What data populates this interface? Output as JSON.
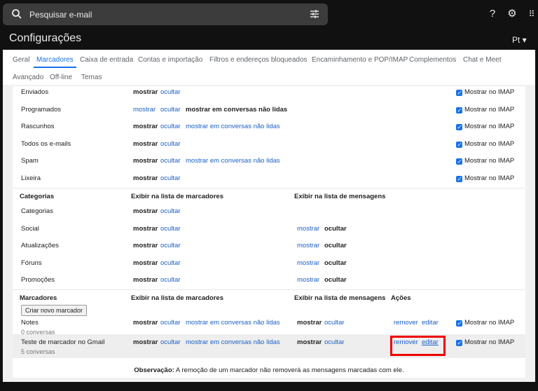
{
  "search": {
    "placeholder": "Pesquisar e-mail"
  },
  "header": {
    "title": "Configurações",
    "lang": "Pt ▾"
  },
  "tabs": [
    "Geral",
    "Marcadores",
    "Caixa de entrada",
    "Contas e importação",
    "Filtros e endereços bloqueados",
    "Encaminhamento e POP/IMAP",
    "Complementos",
    "Chat e Meet",
    "Avançado",
    "Off-line",
    "Temas"
  ],
  "system_labels": [
    {
      "name": "Enviados",
      "show": "mostrar",
      "hide": "ocultar",
      "unread": "",
      "imap": "Mostrar no IMAP",
      "bold": "show"
    },
    {
      "name": "Programados",
      "show": "mostrar",
      "hide": "ocultar",
      "unread": "mostrar em conversas não lidas",
      "imap": "Mostrar no IMAP",
      "bold": "unread"
    },
    {
      "name": "Rascunhos",
      "show": "mostrar",
      "hide": "ocultar",
      "unread": "mostrar em conversas não lidas",
      "imap": "Mostrar no IMAP",
      "bold": "show"
    },
    {
      "name": "Todos os e-mails",
      "show": "mostrar",
      "hide": "ocultar",
      "unread": "",
      "imap": "Mostrar no IMAP",
      "bold": "show"
    },
    {
      "name": "Spam",
      "show": "mostrar",
      "hide": "ocultar",
      "unread": "mostrar em conversas não lidas",
      "imap": "Mostrar no IMAP",
      "bold": "show"
    },
    {
      "name": "Lixeira",
      "show": "mostrar",
      "hide": "ocultar",
      "unread": "",
      "imap": "Mostrar no IMAP",
      "bold": "show"
    }
  ],
  "categories": {
    "header": "Categorias",
    "col_label_list": "Exibir na lista de marcadores",
    "col_msg_list": "Exibir na lista de mensagens",
    "rows": [
      {
        "name": "Categorias",
        "show": "mostrar",
        "hide": "ocultar",
        "mshow": "",
        "mhide": ""
      },
      {
        "name": "Social",
        "show": "mostrar",
        "hide": "ocultar",
        "mshow": "mostrar",
        "mhide": "ocultar"
      },
      {
        "name": "Atualizações",
        "show": "mostrar",
        "hide": "ocultar",
        "mshow": "mostrar",
        "mhide": "ocultar"
      },
      {
        "name": "Fóruns",
        "show": "mostrar",
        "hide": "ocultar",
        "mshow": "mostrar",
        "mhide": "ocultar"
      },
      {
        "name": "Promoções",
        "show": "mostrar",
        "hide": "ocultar",
        "mshow": "mostrar",
        "mhide": "ocultar"
      }
    ]
  },
  "labels": {
    "header": "Marcadores",
    "col_label_list": "Exibir na lista de marcadores",
    "col_msg_list": "Exibir na lista de mensagens",
    "col_actions": "Ações",
    "create_button": "Criar novo marcador",
    "rows": [
      {
        "name": "Notes",
        "count": "0 conversas",
        "show": "mostrar",
        "hide": "ocultar",
        "unread": "mostrar em conversas não lidas",
        "mshow": "mostrar",
        "mhide": "ocultar",
        "remove": "remover",
        "edit": "editar",
        "imap": "Mostrar no IMAP"
      },
      {
        "name": "Teste de marcador no Gmail",
        "count": "5 conversas",
        "show": "mostrar",
        "hide": "ocultar",
        "unread": "mostrar em conversas não lidas",
        "mshow": "mostrar",
        "mhide": "ocultar",
        "remove": "remover",
        "edit": "editar",
        "imap": "Mostrar no IMAP"
      }
    ]
  },
  "note": {
    "bold": "Observação:",
    "text": " A remoção de um marcador não removerá as mensagens marcadas com ele."
  }
}
